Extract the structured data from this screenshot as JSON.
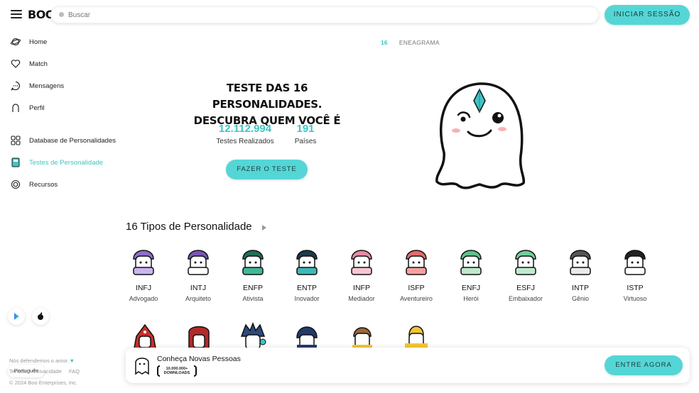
{
  "header": {
    "logo": "BOO",
    "search_placeholder": "Buscar",
    "login_label": "INICIAR SESSÃO"
  },
  "sidebar": {
    "items": [
      {
        "label": "Home",
        "icon": "planet-icon"
      },
      {
        "label": "Match",
        "icon": "heart-icon"
      },
      {
        "label": "Mensagens",
        "icon": "chat-icon"
      },
      {
        "label": "Perfil",
        "icon": "ghost-icon"
      },
      {
        "label": "Database de Personalidades",
        "icon": "grid-icon"
      },
      {
        "label": "Testes de Personalidade",
        "icon": "test-icon",
        "active": true
      },
      {
        "label": "Recursos",
        "icon": "resources-icon"
      }
    ],
    "language": "Português",
    "tagline": "Nós defendemos o amor.",
    "links": [
      "Termos",
      "Privacidade",
      "FAQ"
    ],
    "copyright": "© 2024 Boo Enterprises, Inc."
  },
  "tabs": {
    "primary": "16",
    "secondary": "ENEAGRAMA"
  },
  "hero": {
    "title_line1": "TESTE DAS 16 PERSONALIDADES.",
    "title_line2": "DESCUBRA QUEM VOCÊ É",
    "stats": [
      {
        "value": "12.112.994",
        "label": "Testes Realizados"
      },
      {
        "value": "191",
        "label": "Países"
      }
    ],
    "cta": "FAZER O TESTE"
  },
  "types_section": {
    "title": "16 Tipos de Personalidade",
    "types": [
      {
        "code": "INFJ",
        "name": "Advogado"
      },
      {
        "code": "INTJ",
        "name": "Arquiteto"
      },
      {
        "code": "ENFP",
        "name": "Ativista"
      },
      {
        "code": "ENTP",
        "name": "Inovador"
      },
      {
        "code": "INFP",
        "name": "Mediador"
      },
      {
        "code": "ISFP",
        "name": "Aventureiro"
      },
      {
        "code": "ENFJ",
        "name": "Herói"
      },
      {
        "code": "ESFJ",
        "name": "Embaixador"
      },
      {
        "code": "INTP",
        "name": "Gênio"
      },
      {
        "code": "ISTP",
        "name": "Virtuoso"
      }
    ]
  },
  "banner": {
    "title": "Conheça Novas Pessoas",
    "downloads_line1": "10.000.000+",
    "downloads_line2": "DOWNLOADS",
    "button": "ENTRE AGORA"
  },
  "colors": {
    "accent": "#55d6d6",
    "accent_text": "#3fc4c4"
  }
}
